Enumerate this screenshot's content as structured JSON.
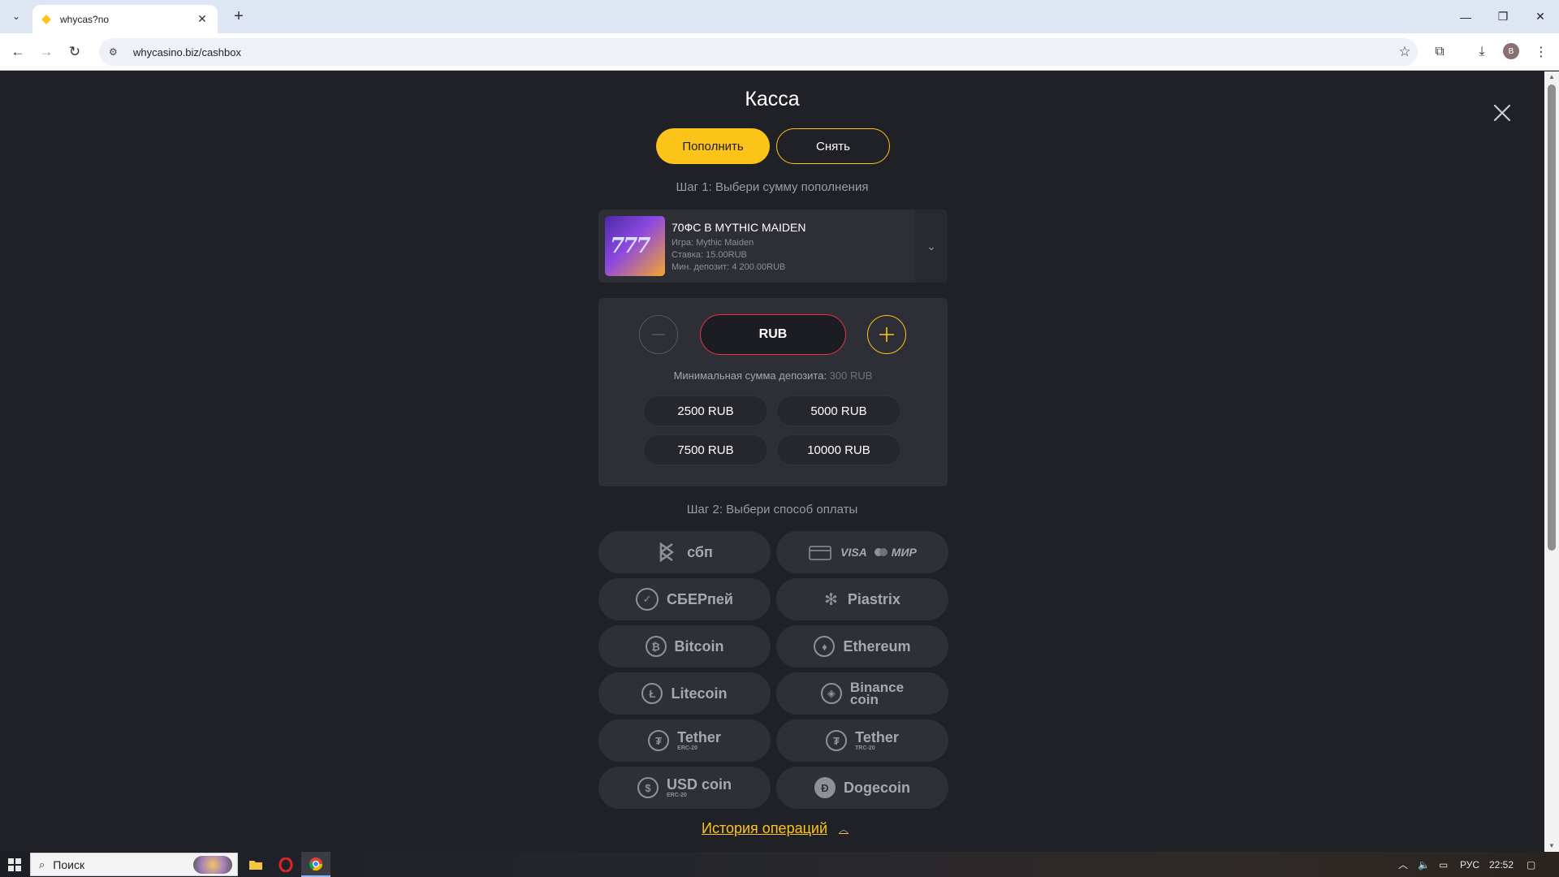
{
  "browser": {
    "tab_title": "whycas?no",
    "url": "whycasino.biz/cashbox",
    "profile_initial": "B"
  },
  "cashbox": {
    "title": "Касса",
    "deposit_tab": "Пополнить",
    "withdraw_tab": "Снять",
    "step1": "Шаг 1: Выбери сумму пополнения",
    "bonus": {
      "title": "70ФС В MYTHIC MAIDEN",
      "game": "Игра: Mythic Maiden",
      "bet": "Ставка: 15.00RUB",
      "min_deposit": "Мин. депозит: 4 200.00RUB"
    },
    "amount": {
      "currency": "RUB",
      "min_label": "Минимальная сумма депозита:",
      "min_value": "300 RUB",
      "presets": [
        "2500 RUB",
        "5000 RUB",
        "7500 RUB",
        "10000 RUB"
      ]
    },
    "step2": "Шаг 2: Выбери способ оплаты",
    "methods": [
      {
        "name": "сбп",
        "sub": ""
      },
      {
        "name": "VISA",
        "sub": "МИР"
      },
      {
        "name": "СБЕРпей",
        "sub": ""
      },
      {
        "name": "Piastrix",
        "sub": ""
      },
      {
        "name": "Bitcoin",
        "sub": ""
      },
      {
        "name": "Ethereum",
        "sub": ""
      },
      {
        "name": "Litecoin",
        "sub": ""
      },
      {
        "name": "Binance coin",
        "sub": ""
      },
      {
        "name": "Tether",
        "sub": "ERC-20"
      },
      {
        "name": "Tether",
        "sub": "TRC-20"
      },
      {
        "name": "USD coin",
        "sub": "ERC-20"
      },
      {
        "name": "Dogecoin",
        "sub": ""
      }
    ],
    "binance_line1": "Binance",
    "binance_line2": "coin",
    "history": "История операций"
  },
  "taskbar": {
    "search_placeholder": "Поиск",
    "lang": "РУС",
    "time": "22:52"
  },
  "colors": {
    "accent": "#fcc419",
    "background": "#202127",
    "panel": "#2e2f36",
    "error_border": "#e8333c"
  }
}
